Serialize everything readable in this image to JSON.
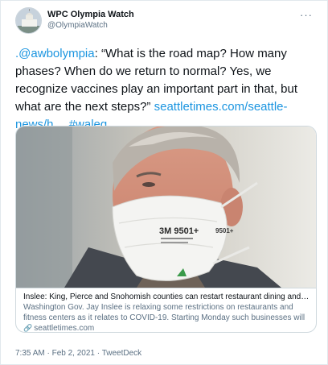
{
  "account": {
    "display_name": "WPC Olympia Watch",
    "handle": "@OlympiaWatch"
  },
  "tweet": {
    "mention": ".@awbolympia",
    "quote": ": “What is the road map? How many phases? When do we return to normal? Yes, we recognize vaccines play an important part in that, but what are the next steps?” ",
    "url_text": "seattletimes.com/seattle-news/h…",
    "hashtag": "#waleg"
  },
  "card": {
    "title": "Inslee: King, Pierce and Snohomish counties can restart restaurant dining and fit…",
    "description": "Washington Gov. Jay Inslee is relaxing some restrictions on restaurants and fitness centers as it relates to COVID-19. Starting Monday such businesses will be allowe…",
    "domain": "seattletimes.com",
    "mask_text_1": "3M 9501+",
    "mask_text_2": "9501+"
  },
  "meta": {
    "time": "7:35 AM",
    "separator": " · ",
    "date": "Feb 2, 2021",
    "source": "TweetDeck"
  },
  "colors": {
    "link": "#1b95e0",
    "secondary_text": "#5b7083",
    "border": "#cfd9de"
  }
}
